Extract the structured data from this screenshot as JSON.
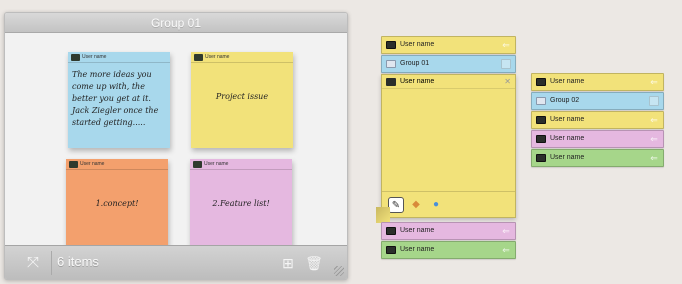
{
  "group_window": {
    "title": "Group 01",
    "item_count": "6 items",
    "notes": [
      {
        "user": "User name",
        "text": "The more ideas you come up with, the better you get at it. Jack Ziegler once the started getting.....",
        "color": "#a8d8ec"
      },
      {
        "user": "User name",
        "text": "Project issue",
        "color": "#f2e27a"
      },
      {
        "user": "User name",
        "text": "1.concept!",
        "color": "#f3a06d"
      },
      {
        "user": "User name",
        "text": "2.Feature list!",
        "color": "#e5b8e0"
      }
    ]
  },
  "middle_panel": {
    "bars": [
      {
        "label": "User name",
        "color": "#f2e27a"
      },
      {
        "label": "Group 01",
        "color": "#a8d8ec"
      }
    ],
    "open_note": {
      "user": "User name",
      "color": "#f2e27a"
    },
    "bottom_bars": [
      {
        "label": "User name",
        "color": "#e5b8e0"
      },
      {
        "label": "User name",
        "color": "#a6d68a"
      }
    ]
  },
  "right_panel": {
    "bars": [
      {
        "label": "User name",
        "color": "#f2e27a"
      },
      {
        "label": "Group 02",
        "color": "#a8d8ec"
      },
      {
        "label": "User name",
        "color": "#f2e27a"
      },
      {
        "label": "User name",
        "color": "#e5b8e0"
      },
      {
        "label": "User name",
        "color": "#a6d68a"
      }
    ]
  }
}
